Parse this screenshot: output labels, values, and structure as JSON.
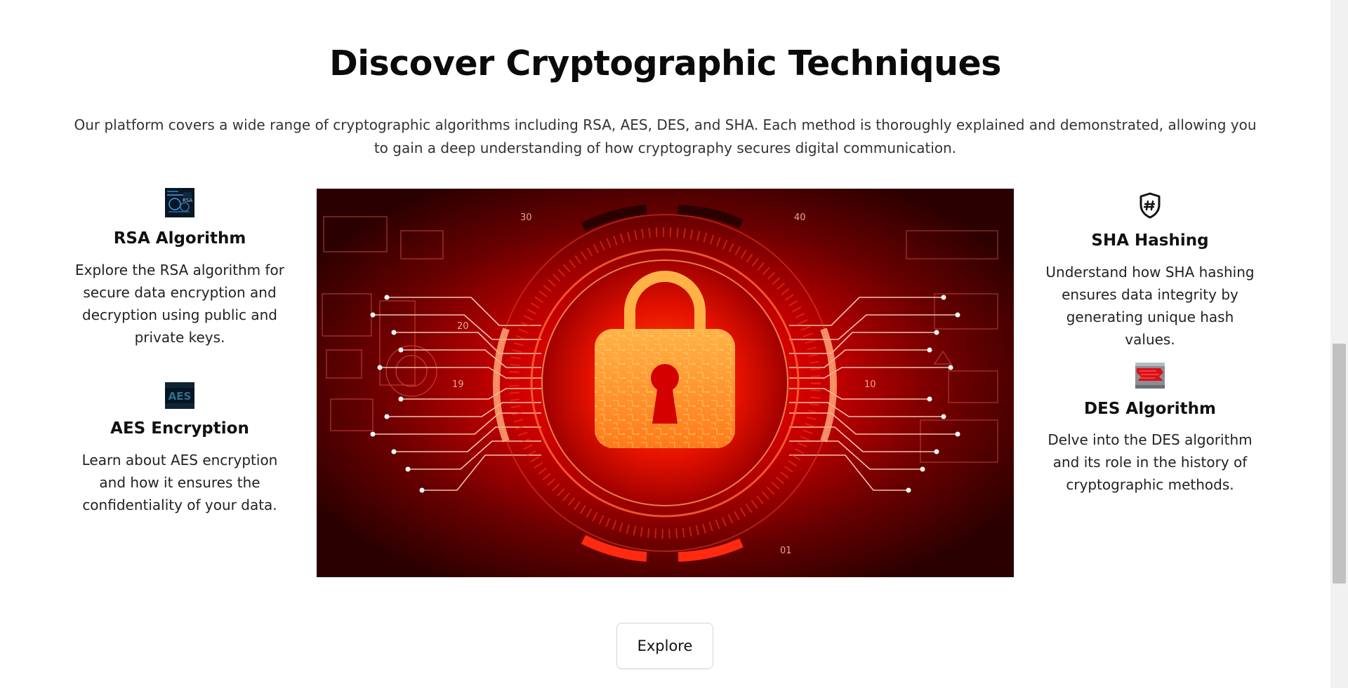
{
  "section": {
    "title": "Discover Cryptographic Techniques",
    "intro": "Our platform covers a wide range of cryptographic algorithms including RSA, AES, DES, and SHA. Each method is thoroughly explained and demonstrated, allowing you to gain a deep understanding of how cryptography secures digital communication."
  },
  "features": {
    "rsa": {
      "title": "RSA Algorithm",
      "description": "Explore the RSA algorithm for secure data encryption and decryption using public and private keys.",
      "icon": "rsa-thumbnail"
    },
    "aes": {
      "title": "AES Encryption",
      "description": "Learn about AES encryption and how it ensures the confidentiality of your data.",
      "thumb_text": "AES",
      "icon": "aes-thumbnail"
    },
    "sha": {
      "title": "SHA Hashing",
      "description": "Understand how SHA hashing ensures data integrity by generating unique hash values.",
      "icon": "shield-hash-icon"
    },
    "des": {
      "title": "DES Algorithm",
      "description": "Delve into the DES algorithm and its role in the history of cryptographic methods.",
      "icon": "des-thumbnail"
    }
  },
  "hero": {
    "image": "red-circuit-padlock",
    "dial_numbers": [
      "19",
      "20",
      "30",
      "40",
      "10",
      "01"
    ]
  },
  "actions": {
    "explore_label": "Explore"
  },
  "colors": {
    "accent_red": "#e00000",
    "lock_orange": "#ff7a1a",
    "button_border": "#d6d6d6"
  }
}
